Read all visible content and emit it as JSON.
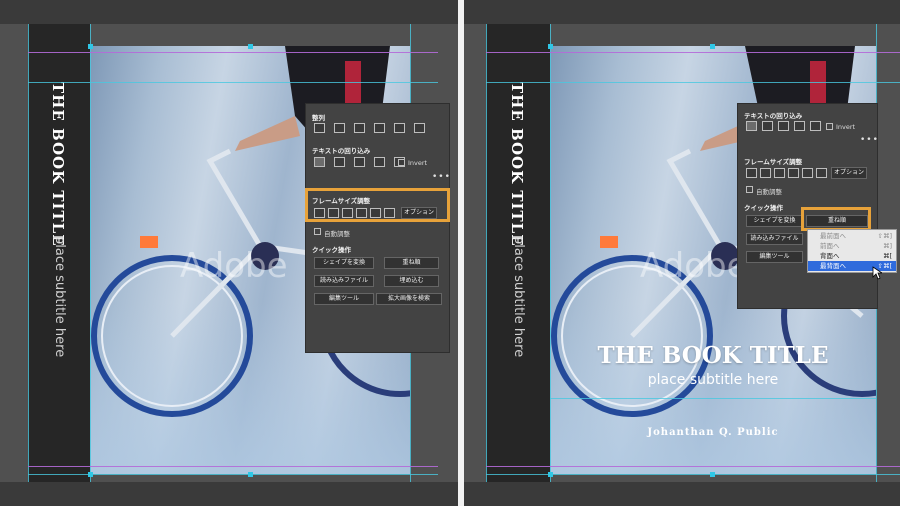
{
  "book": {
    "title": "THE BOOK TITLE",
    "subtitle": "place subtitle here",
    "author": "Johanthan Q. Public",
    "watermark": "Adobe"
  },
  "left_panel": {
    "arrange_heading": "整列",
    "wrap_heading": "テキストの回り込み",
    "invert_label": "Invert",
    "frame_heading": "フレームサイズ調整",
    "options_button": "オプション",
    "autofit_label": "自動調整",
    "quick_heading": "クイック操作",
    "buttons": [
      "シェイプを変換",
      "重ね順",
      "読み込みファイル",
      "埋め込む",
      "編集ツール",
      "拡大画像を検索"
    ],
    "more": "•••"
  },
  "right_panel": {
    "wrap_heading": "テキストの回り込み",
    "invert_label": "Invert",
    "frame_heading": "フレームサイズ調整",
    "options_button": "オプション",
    "autofit_label": "自動調整",
    "quick_heading": "クイック操作",
    "buttons": [
      "シェイプを変換",
      "重ね順",
      "読み込みファイル",
      "編集ツール"
    ],
    "more": "•••",
    "arrange_menu": [
      {
        "label": "最前面へ",
        "shortcut": "⇧⌘]",
        "state": "disabled"
      },
      {
        "label": "前面へ",
        "shortcut": "⌘]",
        "state": "disabled"
      },
      {
        "label": "背面へ",
        "shortcut": "⌘[",
        "state": "normal"
      },
      {
        "label": "最背面へ",
        "shortcut": "⇧⌘[",
        "state": "active"
      }
    ]
  },
  "colors": {
    "highlight": "#e7a23a",
    "guide_cyan": "#48c8e0",
    "guide_purple": "#b46ad8",
    "menu_active": "#2f6bdc",
    "panel_bg": "#434343"
  }
}
